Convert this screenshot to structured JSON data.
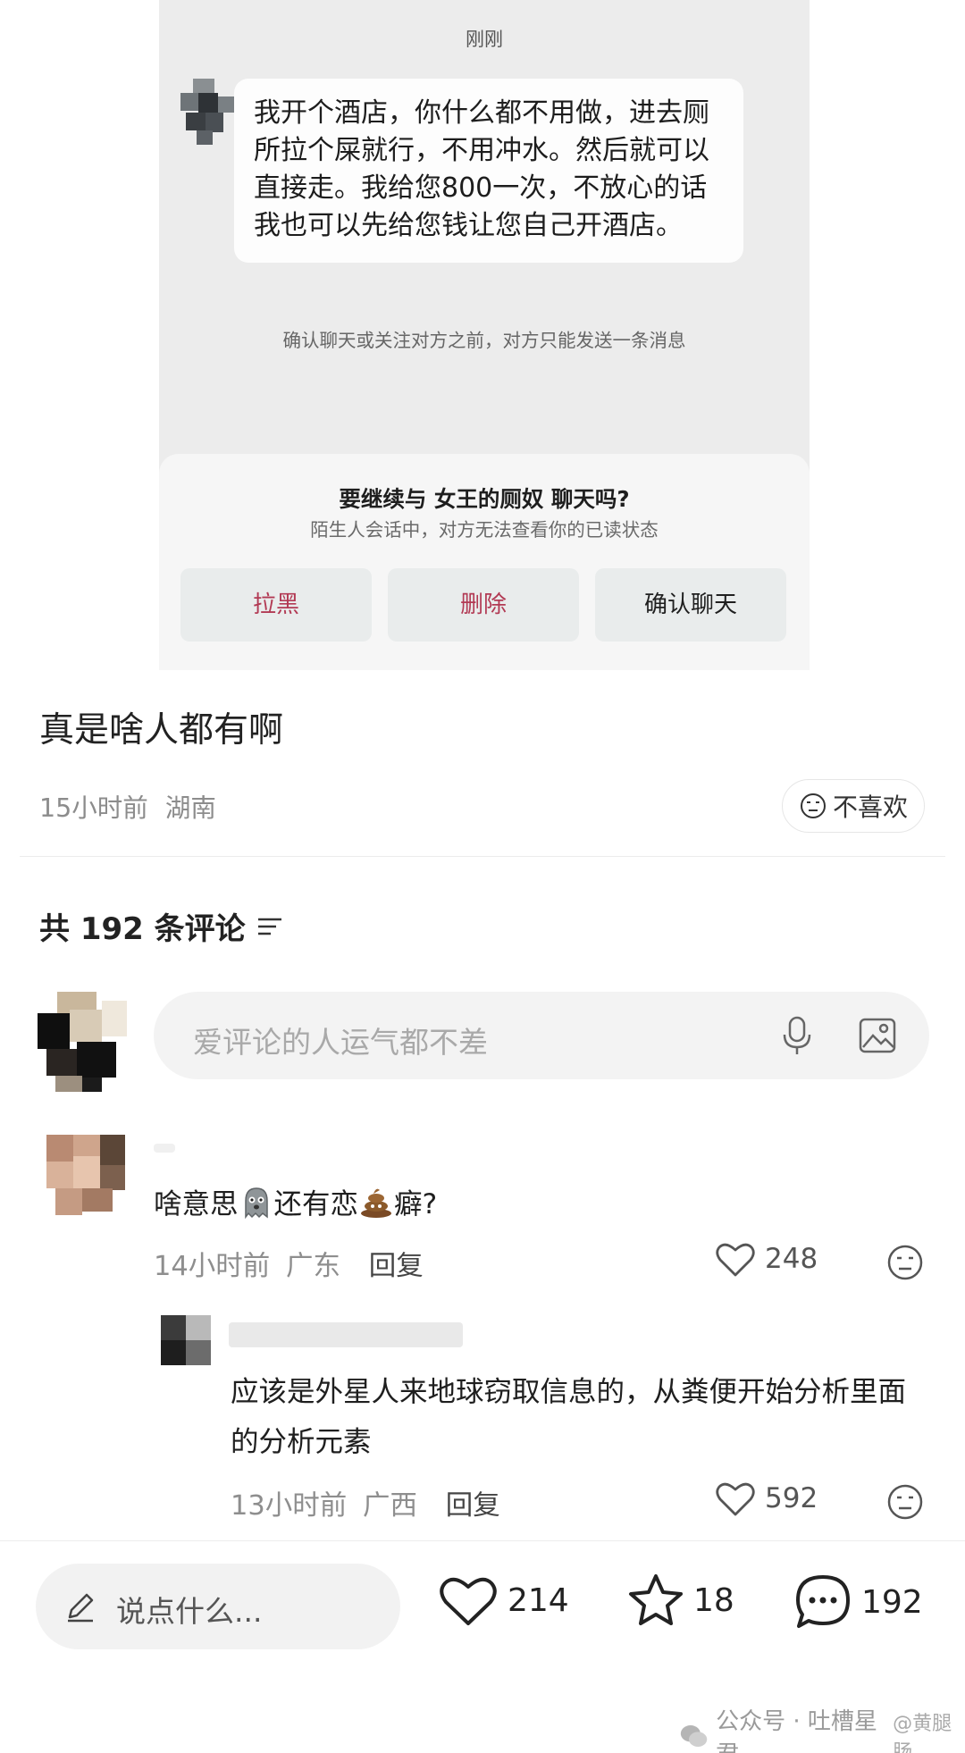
{
  "chat_screenshot": {
    "time_label": "刚刚",
    "message": "我开个酒店，你什么都不用做，进去厕所拉个屎就行，不用冲水。然后就可以直接走。我给您800一次，不放心的话我也可以先给您钱让您自己开酒店。",
    "notice": "确认聊天或关注对方之前，对方只能发送一条消息",
    "dialog": {
      "title": "要继续与 女王的厕奴 聊天吗?",
      "subtitle": "陌生人会话中，对方无法查看你的已读状态",
      "buttons": {
        "block": "拉黑",
        "delete": "删除",
        "confirm": "确认聊天"
      }
    }
  },
  "post": {
    "text": "真是啥人都有啊",
    "time": "15小时前",
    "location": "湖南",
    "dislike_label": "不喜欢"
  },
  "comments_header": {
    "label": "共 192 条评论"
  },
  "comment_input": {
    "placeholder": "爱评论的人运气都不差"
  },
  "comments": [
    {
      "text_before": "啥意思",
      "text_middle": "还有恋",
      "text_after": "癖?",
      "time": "14小时前",
      "location": "广东",
      "reply_label": "回复",
      "likes": "248"
    },
    {
      "text": "应该是外星人来地球窃取信息的，从粪便开始分析里面的分析元素",
      "time": "13小时前",
      "location": "广西",
      "reply_label": "回复",
      "likes": "592"
    }
  ],
  "bottom_bar": {
    "input_placeholder": "说点什么...",
    "likes": "214",
    "favorites": "18",
    "comments": "192"
  },
  "watermark": {
    "text": "公众号 · 吐槽星君",
    "handle": "@黄腿肠"
  },
  "colors": {
    "accent_red": "#b23a54",
    "chat_bg": "#ececec"
  }
}
